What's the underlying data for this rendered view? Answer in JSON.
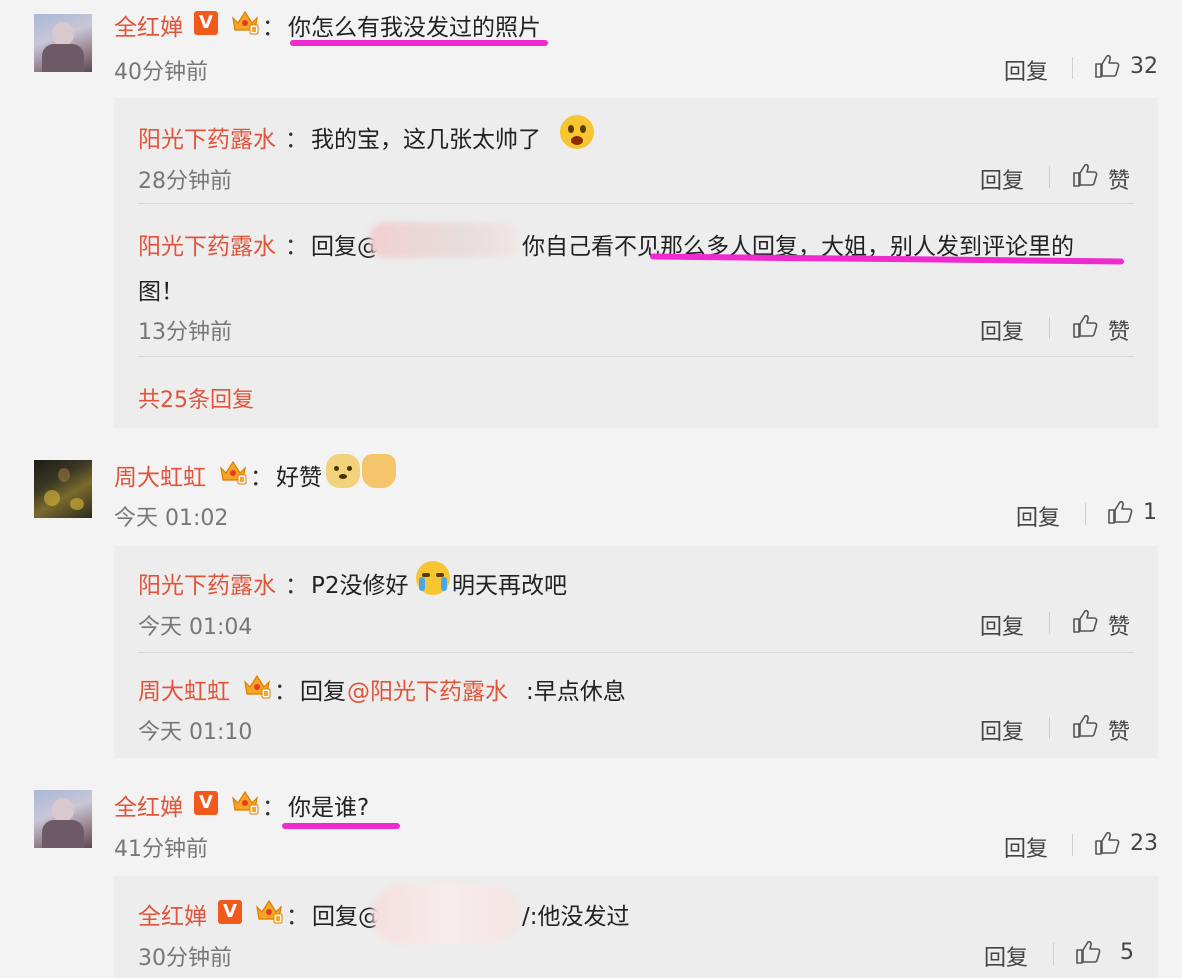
{
  "comments": [
    {
      "user": "全红婵",
      "text": "你怎么有我没发过的照片",
      "time": "40分钟前",
      "reply_label": "回复",
      "likes": "32",
      "replies": [
        {
          "user": "阳光下药露水",
          "text": "我的宝，这几张太帅了",
          "time": "28分钟前",
          "reply_label": "回复",
          "likes": "赞"
        },
        {
          "user": "阳光下药露水",
          "text_prefix": "回复@",
          "text": "你自己看不见那么多人回复，大姐，别人发到评论里的",
          "text_line2": "图！",
          "time": "13分钟前",
          "reply_label": "回复",
          "likes": "赞"
        }
      ],
      "more_replies": "共25条回复"
    },
    {
      "user": "周大虹虹",
      "text": "好赞",
      "time": "今天 01:02",
      "reply_label": "回复",
      "likes": "1",
      "replies": [
        {
          "user": "阳光下药露水",
          "text": "P2没修好",
          "text_suffix": "明天再改吧",
          "time": "今天 01:04",
          "reply_label": "回复",
          "likes": "赞"
        },
        {
          "user": "周大虹虹",
          "text_prefix": "回复",
          "mention": "@阳光下药露水",
          "text": ":早点休息",
          "time": "今天 01:10",
          "reply_label": "回复",
          "likes": "赞"
        }
      ]
    },
    {
      "user": "全红婵",
      "text": "你是谁?",
      "time": "41分钟前",
      "reply_label": "回复",
      "likes": "23",
      "replies": [
        {
          "user": "全红婵",
          "text_prefix": "回复@",
          "text": "/:他没发过",
          "time": "30分钟前",
          "reply_label": "回复",
          "likes": "5"
        }
      ]
    }
  ],
  "colon": "：",
  "verified_badge": "V",
  "colors": {
    "username": "#e0543a",
    "highlight": "#ef2bd0",
    "badge": "#f25a1d"
  },
  "icons": [
    "thumbs-up-icon",
    "verified-badge-icon",
    "crown-badge-icon"
  ]
}
